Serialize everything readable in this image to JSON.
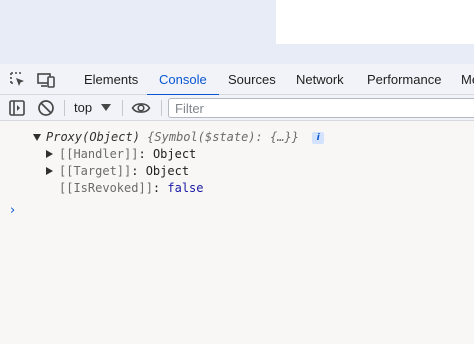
{
  "tabs": [
    {
      "label": "Elements",
      "active": false
    },
    {
      "label": "Console",
      "active": true
    },
    {
      "label": "Sources",
      "active": false
    },
    {
      "label": "Network",
      "active": false
    },
    {
      "label": "Performance",
      "active": false
    },
    {
      "label": "Me",
      "active": false
    }
  ],
  "toolbar": {
    "context": "top",
    "filter_placeholder": "Filter"
  },
  "console": {
    "object_head": "Proxy(Object)",
    "object_preview_open": "{",
    "object_preview_key": "Symbol($state)",
    "object_preview_colon": ": ",
    "object_preview_value": "{…}",
    "object_preview_close": "}",
    "info_badge": "i",
    "properties": [
      {
        "key": "[[Handler]]",
        "value": "Object"
      },
      {
        "key": "[[Target]]",
        "value": "Object"
      },
      {
        "key": "[[IsRevoked]]",
        "value": "false"
      }
    ],
    "prompt": "›"
  },
  "colors": {
    "accent": "#0b57d0",
    "keyword": "#1a1aa6"
  }
}
